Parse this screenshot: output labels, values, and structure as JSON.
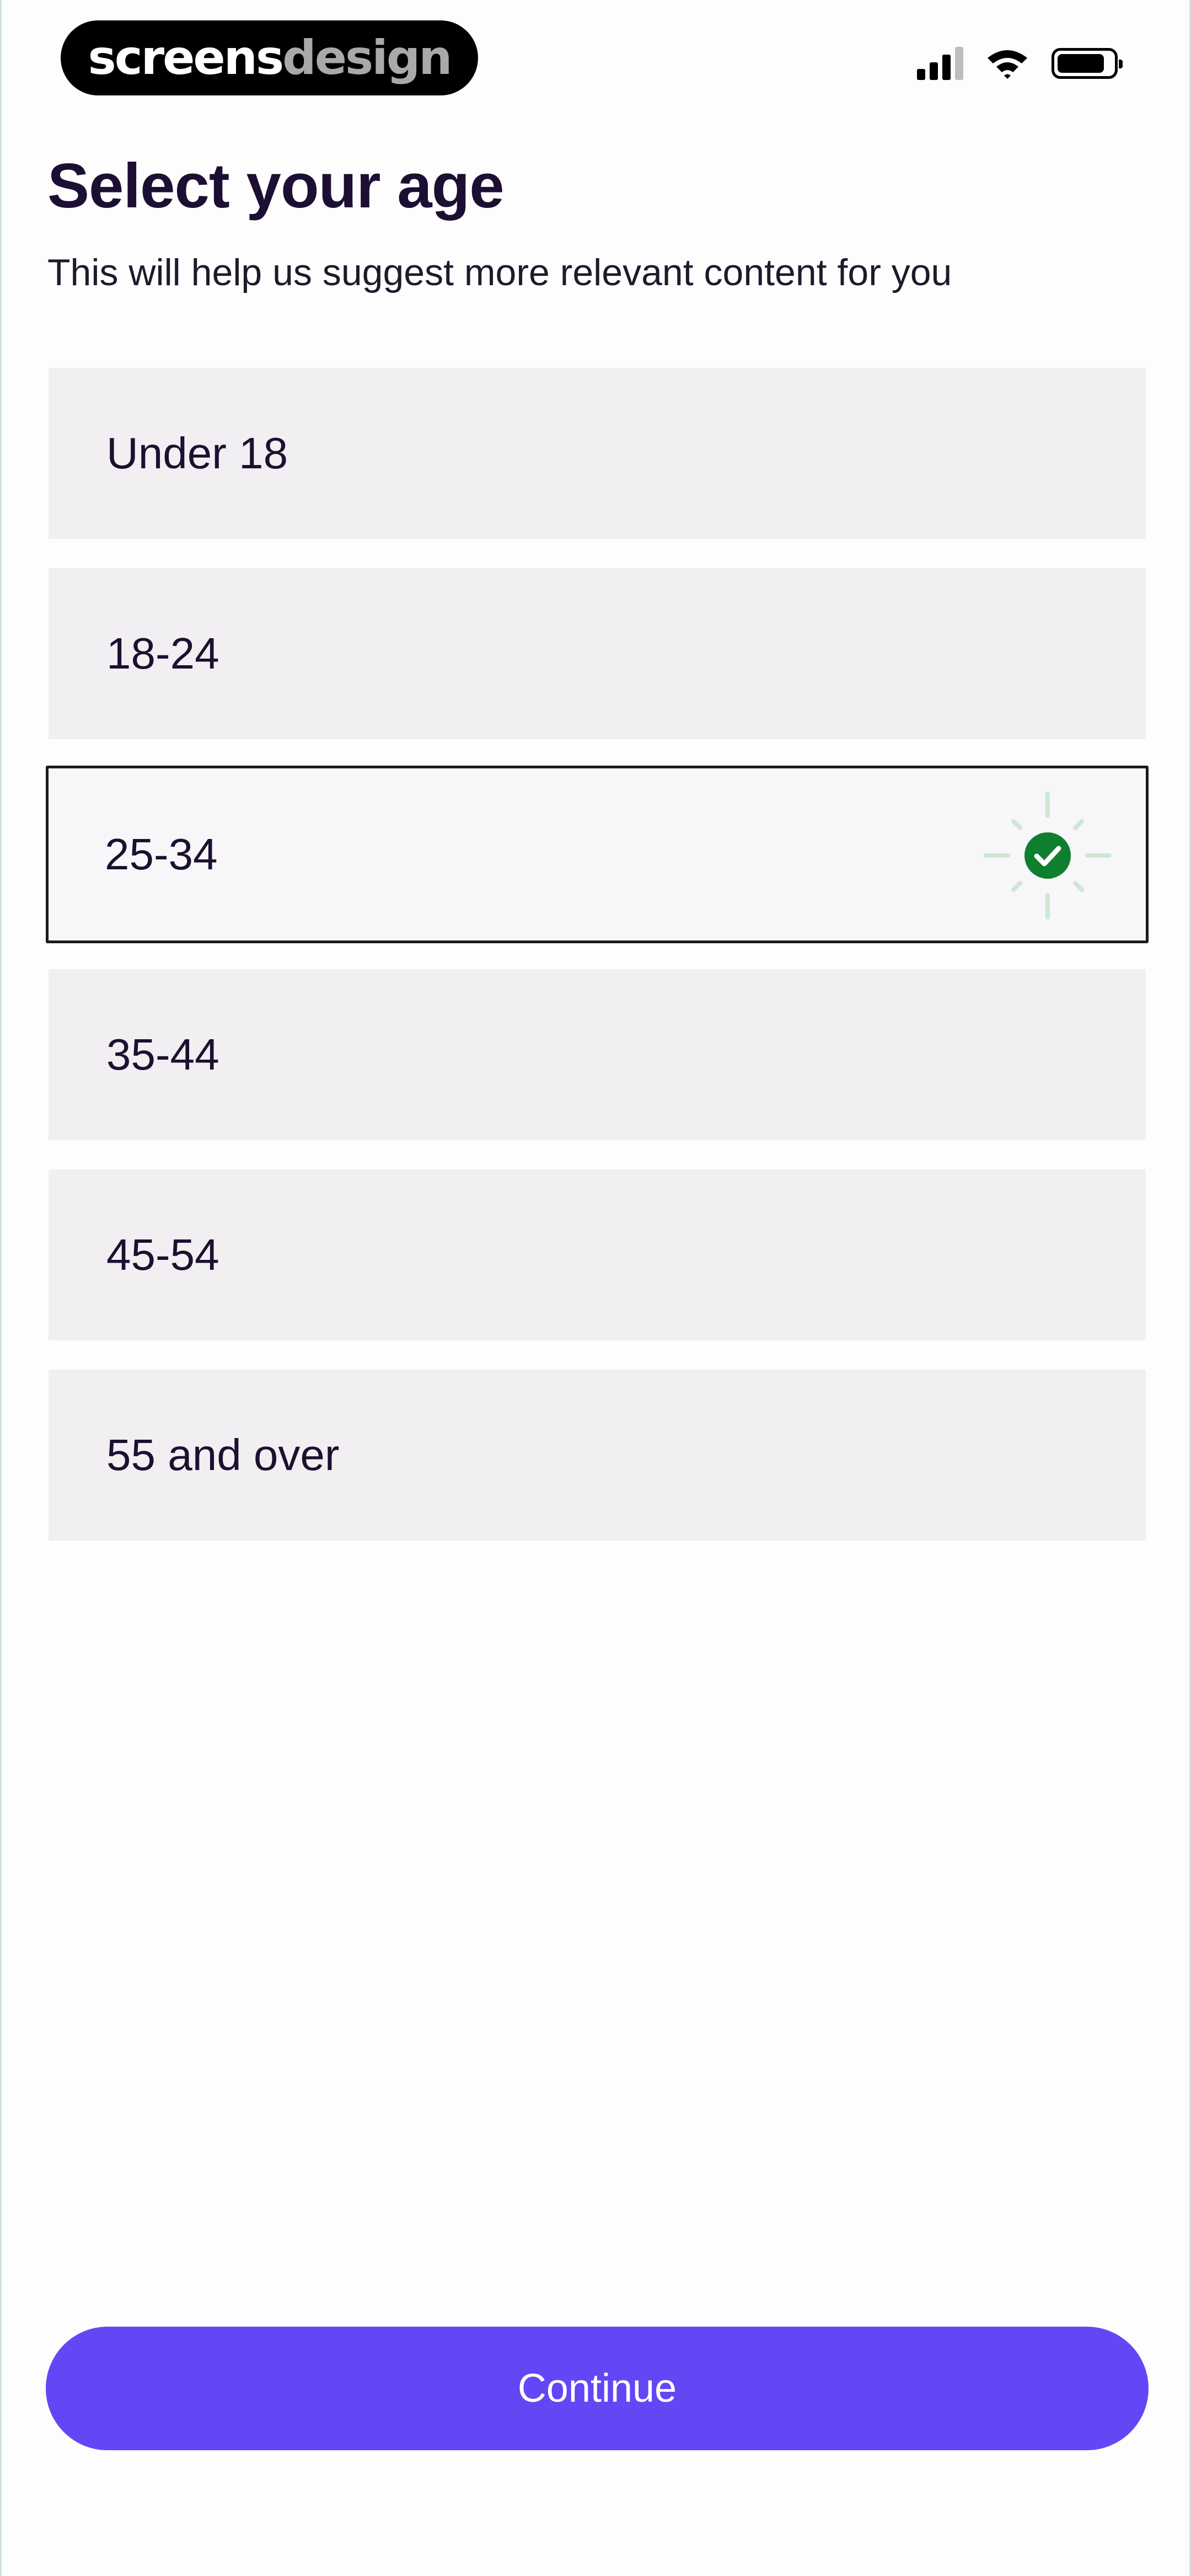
{
  "status_bar": {
    "brand_part1": "screens",
    "brand_part2": "design",
    "icons": [
      "cellular-signal-icon",
      "wifi-icon",
      "battery-icon"
    ]
  },
  "header": {
    "title": "Select your age",
    "subtitle": "This will help us suggest more relevant content for you"
  },
  "options": [
    {
      "label": "Under 18",
      "selected": false
    },
    {
      "label": "18-24",
      "selected": false
    },
    {
      "label": "25-34",
      "selected": true
    },
    {
      "label": "35-44",
      "selected": false
    },
    {
      "label": "45-54",
      "selected": false
    },
    {
      "label": "55 and over",
      "selected": false
    }
  ],
  "selected_icon": "checkmark-circle-icon",
  "footer": {
    "continue_label": "Continue"
  },
  "colors": {
    "accent": "#6347f4",
    "check": "#0e7f2e",
    "option_bg": "#f1eff2",
    "title": "#1c0f33"
  }
}
